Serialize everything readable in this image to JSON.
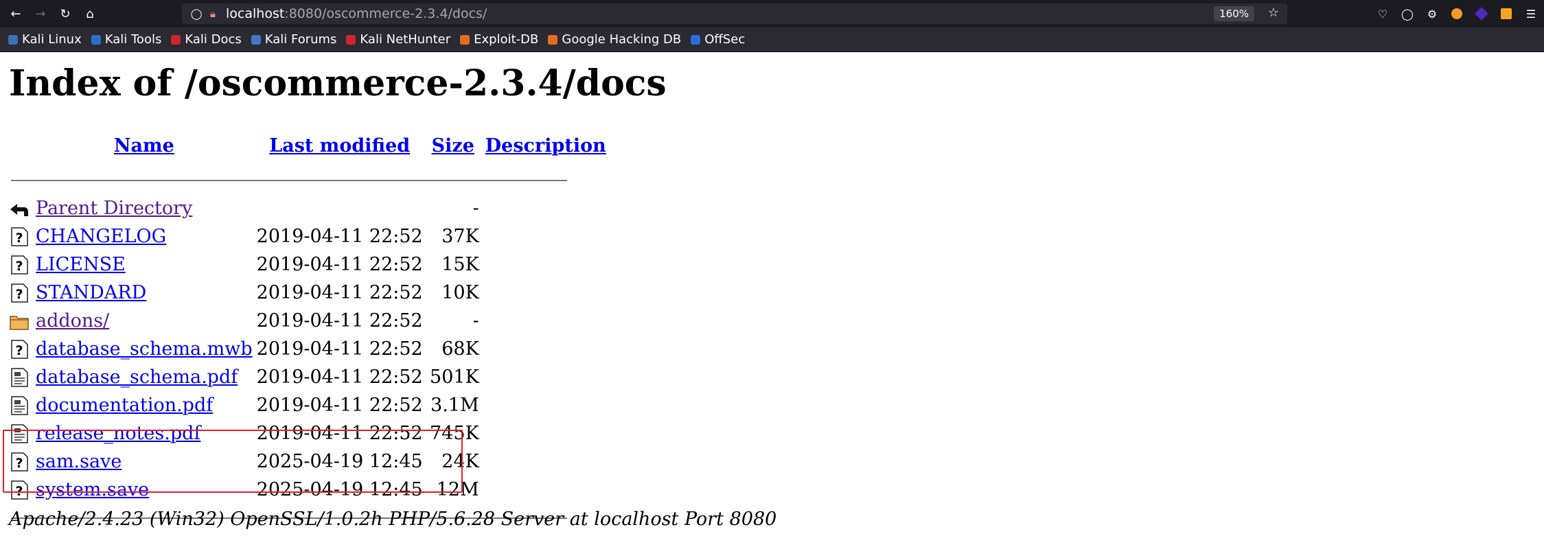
{
  "browser": {
    "url_host": "localhost",
    "url_rest": ":8080/oscommerce-2.3.4/docs/",
    "zoom": "160%",
    "bookmarks": [
      {
        "label": "Kali Linux",
        "color": "#3c6fb4"
      },
      {
        "label": "Kali Tools",
        "color": "#2f6ec7"
      },
      {
        "label": "Kali Docs",
        "color": "#d0252c"
      },
      {
        "label": "Kali Forums",
        "color": "#3f78c9"
      },
      {
        "label": "Kali NetHunter",
        "color": "#d0252c"
      },
      {
        "label": "Exploit-DB",
        "color": "#e46c1c"
      },
      {
        "label": "Google Hacking DB",
        "color": "#e46c1c"
      },
      {
        "label": "OffSec",
        "color": "#2a6de0"
      }
    ]
  },
  "page": {
    "title": "Index of /oscommerce-2.3.4/docs",
    "columns": {
      "name": "Name",
      "modified": "Last modified",
      "size": "Size",
      "description": "Description"
    },
    "rows": [
      {
        "icon": "back",
        "name": "Parent Directory",
        "modified": "",
        "size": "-",
        "visited": true
      },
      {
        "icon": "unknown",
        "name": "CHANGELOG",
        "modified": "2019-04-11 22:52",
        "size": "37K",
        "visited": false
      },
      {
        "icon": "unknown",
        "name": "LICENSE",
        "modified": "2019-04-11 22:52",
        "size": "15K",
        "visited": false
      },
      {
        "icon": "unknown",
        "name": "STANDARD",
        "modified": "2019-04-11 22:52",
        "size": "10K",
        "visited": false
      },
      {
        "icon": "folder",
        "name": "addons/",
        "modified": "2019-04-11 22:52",
        "size": "-",
        "visited": true
      },
      {
        "icon": "unknown",
        "name": "database_schema.mwb",
        "modified": "2019-04-11 22:52",
        "size": "68K",
        "visited": false
      },
      {
        "icon": "layout",
        "name": "database_schema.pdf",
        "modified": "2019-04-11 22:52",
        "size": "501K",
        "visited": false
      },
      {
        "icon": "layout",
        "name": "documentation.pdf",
        "modified": "2019-04-11 22:52",
        "size": "3.1M",
        "visited": false
      },
      {
        "icon": "layout",
        "name": "release_notes.pdf",
        "modified": "2019-04-11 22:52",
        "size": "745K",
        "visited": false
      },
      {
        "icon": "unknown",
        "name": "sam.save",
        "modified": "2025-04-19 12:45",
        "size": "24K",
        "visited": false
      },
      {
        "icon": "unknown",
        "name": "system.save",
        "modified": "2025-04-19 12:45",
        "size": "12M",
        "visited": false
      }
    ],
    "address": "Apache/2.4.23 (Win32) OpenSSL/1.0.2h PHP/5.6.28 Server at localhost Port 8080",
    "highlight_color": "#e0202a"
  }
}
